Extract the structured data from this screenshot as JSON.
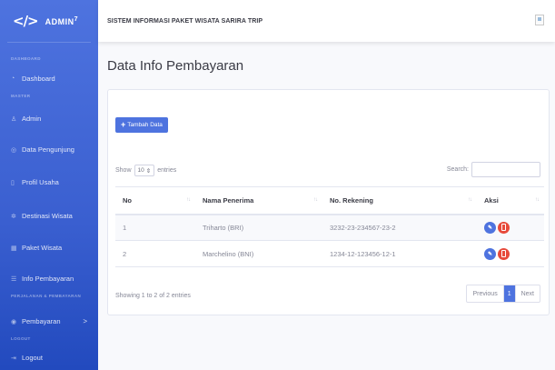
{
  "sidebar": {
    "brand_icon": "</>",
    "brand_name": "ADMIN",
    "brand_sup": "7",
    "headings": {
      "dashboard": "DASHBOARD",
      "master": "MASTER",
      "perjalanan": "PERJALANAN & PEMBAYARAN",
      "logout": "LOGOUT"
    },
    "items": [
      {
        "label": "Dashboard",
        "icon": "dashboard-icon"
      },
      {
        "label": "Admin",
        "icon": "user-icon"
      },
      {
        "label": "Data Pengunjung",
        "icon": "users-icon"
      },
      {
        "label": "Profil Usaha",
        "icon": "file-icon"
      },
      {
        "label": "Destinasi Wisata",
        "icon": "map-icon"
      },
      {
        "label": "Paket Wisata",
        "icon": "calendar-icon"
      },
      {
        "label": "Info Pembayaran",
        "icon": "list-icon"
      },
      {
        "label": "Pembayaran",
        "icon": "money-icon",
        "chevron": ">"
      },
      {
        "label": "Logout",
        "icon": "logout-icon"
      }
    ]
  },
  "topbar": {
    "title": "SISTEM INFORMASI PAKET WISATA SARIRA TRIP"
  },
  "main": {
    "page_title": "Data Info Pembayaran",
    "add_button": "Tambah Data",
    "show_label": "Show",
    "show_value": "10",
    "entries_label": "entries",
    "search_label": "Search:",
    "columns": [
      "No",
      "Nama Penerima",
      "No. Rekening",
      "Aksi"
    ],
    "rows": [
      {
        "no": "1",
        "nama": "Triharto (BRI)",
        "rekening": "3232-23-234567-23-2"
      },
      {
        "no": "2",
        "nama": "Marchelino (BNI)",
        "rekening": "1234-12-123456-12-1"
      }
    ],
    "info": "Showing 1 to 2 of 2 entries",
    "pager": {
      "prev": "Previous",
      "current": "1",
      "next": "Next"
    }
  },
  "colors": {
    "primary": "#4e73df",
    "danger": "#e74a3b",
    "sidebar_bottom": "#224abe"
  }
}
